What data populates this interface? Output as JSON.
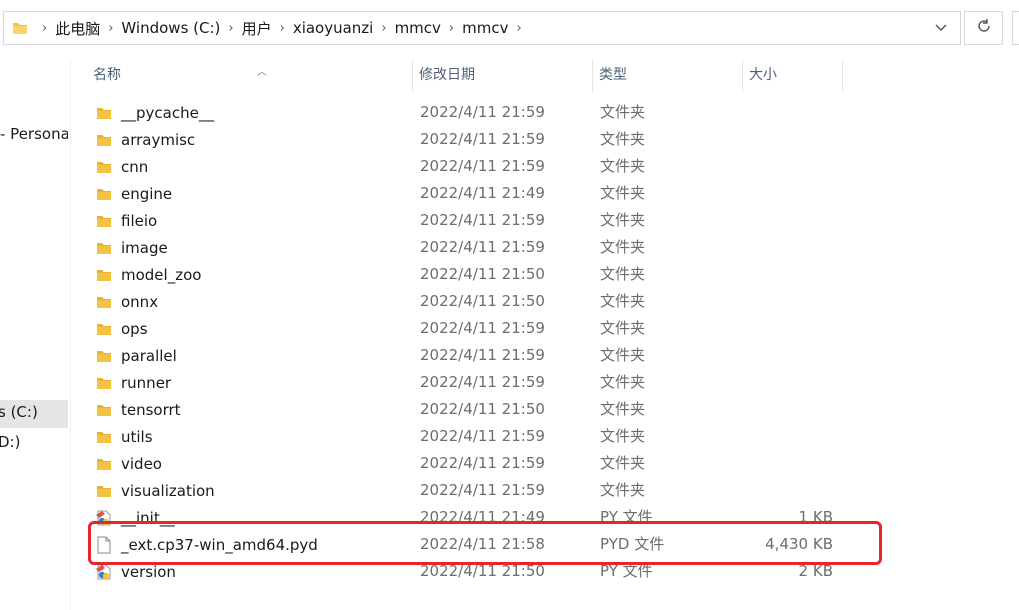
{
  "breadcrumb": {
    "items": [
      "此电脑",
      "Windows (C:)",
      "用户",
      "xiaoyuanzi",
      "mmcv",
      "mmcv"
    ],
    "separator": ">"
  },
  "nav": {
    "items": [
      {
        "label": "- Persona",
        "selected": false
      },
      {
        "label": "s (C:)",
        "selected": true
      },
      {
        "label": "D:)",
        "selected": false
      }
    ]
  },
  "columns": {
    "name": "名称",
    "date": "修改日期",
    "type": "类型",
    "size": "大小"
  },
  "files": [
    {
      "name": "__pycache__",
      "date": "2022/4/11 21:59",
      "type": "文件夹",
      "size": "",
      "icon": "folder-icon"
    },
    {
      "name": "arraymisc",
      "date": "2022/4/11 21:59",
      "type": "文件夹",
      "size": "",
      "icon": "folder-icon"
    },
    {
      "name": "cnn",
      "date": "2022/4/11 21:59",
      "type": "文件夹",
      "size": "",
      "icon": "folder-icon"
    },
    {
      "name": "engine",
      "date": "2022/4/11 21:49",
      "type": "文件夹",
      "size": "",
      "icon": "folder-icon"
    },
    {
      "name": "fileio",
      "date": "2022/4/11 21:59",
      "type": "文件夹",
      "size": "",
      "icon": "folder-icon"
    },
    {
      "name": "image",
      "date": "2022/4/11 21:59",
      "type": "文件夹",
      "size": "",
      "icon": "folder-icon"
    },
    {
      "name": "model_zoo",
      "date": "2022/4/11 21:50",
      "type": "文件夹",
      "size": "",
      "icon": "folder-icon"
    },
    {
      "name": "onnx",
      "date": "2022/4/11 21:50",
      "type": "文件夹",
      "size": "",
      "icon": "folder-icon"
    },
    {
      "name": "ops",
      "date": "2022/4/11 21:59",
      "type": "文件夹",
      "size": "",
      "icon": "folder-icon"
    },
    {
      "name": "parallel",
      "date": "2022/4/11 21:59",
      "type": "文件夹",
      "size": "",
      "icon": "folder-icon"
    },
    {
      "name": "runner",
      "date": "2022/4/11 21:59",
      "type": "文件夹",
      "size": "",
      "icon": "folder-icon"
    },
    {
      "name": "tensorrt",
      "date": "2022/4/11 21:50",
      "type": "文件夹",
      "size": "",
      "icon": "folder-icon"
    },
    {
      "name": "utils",
      "date": "2022/4/11 21:59",
      "type": "文件夹",
      "size": "",
      "icon": "folder-icon"
    },
    {
      "name": "video",
      "date": "2022/4/11 21:59",
      "type": "文件夹",
      "size": "",
      "icon": "folder-icon"
    },
    {
      "name": "visualization",
      "date": "2022/4/11 21:59",
      "type": "文件夹",
      "size": "",
      "icon": "folder-icon"
    },
    {
      "name": "__init__",
      "date": "2022/4/11 21:49",
      "type": "PY 文件",
      "size": "1 KB",
      "icon": "python-file-icon"
    },
    {
      "name": "_ext.cp37-win_amd64.pyd",
      "date": "2022/4/11 21:58",
      "type": "PYD 文件",
      "size": "4,430 KB",
      "icon": "blank-file-icon"
    },
    {
      "name": "version",
      "date": "2022/4/11 21:50",
      "type": "PY 文件",
      "size": "2 KB",
      "icon": "python-file-icon"
    }
  ],
  "colors": {
    "highlight": "#e8262a",
    "folder": "#f5c342",
    "header_text": "#4c607a"
  }
}
